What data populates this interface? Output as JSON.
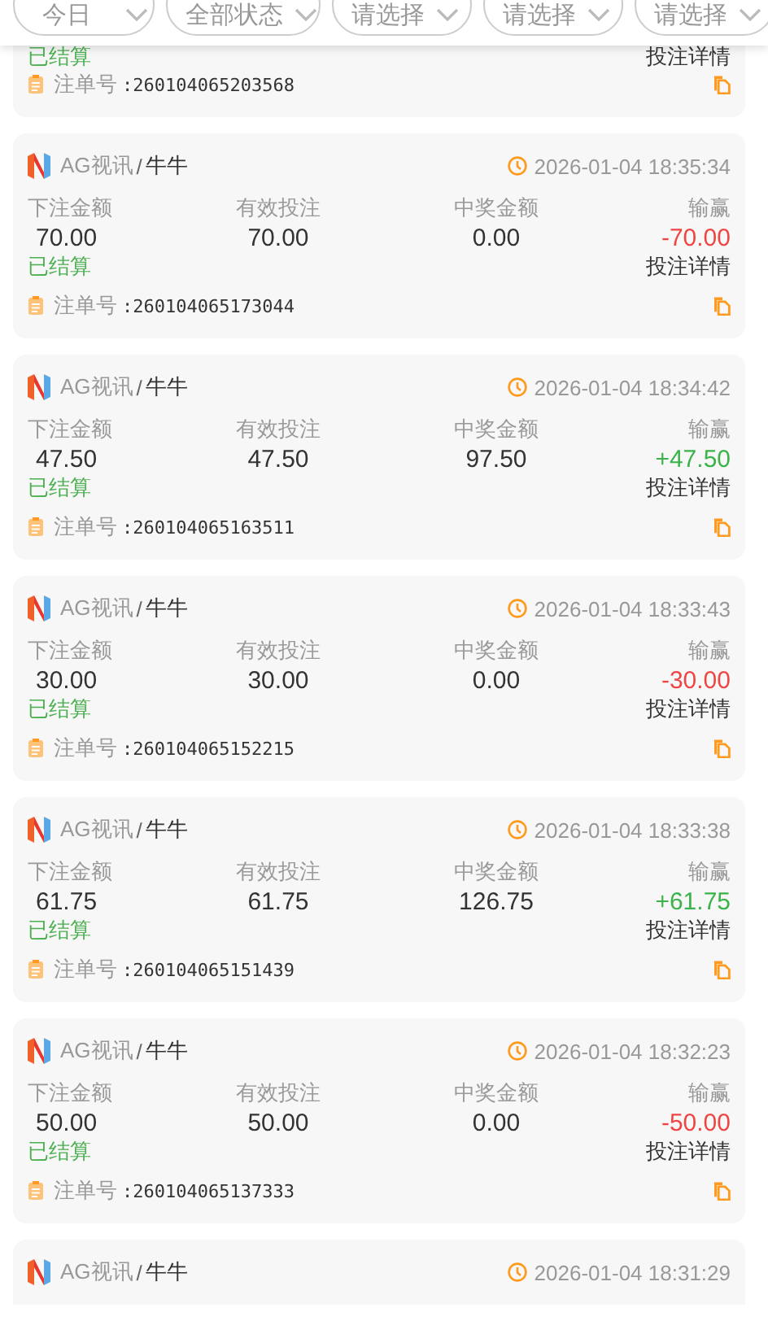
{
  "filters": [
    {
      "label": "今日"
    },
    {
      "label": "全部状态"
    },
    {
      "label": "请选择"
    },
    {
      "label": "请选择"
    },
    {
      "label": "请选择"
    }
  ],
  "bets": [
    {
      "kind": "partial-top",
      "status": "已结算",
      "details_link": "投注详情",
      "order_label": "注单号",
      "order_no": ":260104065203568"
    },
    {
      "kind": "full",
      "platform": "AG视讯",
      "separator": "/",
      "game": "牛牛",
      "time": "2026-01-04 18:35:34",
      "labels": [
        "下注金额",
        "有效投注",
        "中奖金额",
        "输赢"
      ],
      "stake": "70.00",
      "valid": "70.00",
      "payout": "0.00",
      "result": "-70.00",
      "win": false,
      "status": "已结算",
      "details_link": "投注详情",
      "order_label": "注单号",
      "order_no": ":260104065173044"
    },
    {
      "kind": "full",
      "platform": "AG视讯",
      "separator": "/",
      "game": "牛牛",
      "time": "2026-01-04 18:34:42",
      "labels": [
        "下注金额",
        "有效投注",
        "中奖金额",
        "输赢"
      ],
      "stake": "47.50",
      "valid": "47.50",
      "payout": "97.50",
      "result": "+47.50",
      "win": true,
      "status": "已结算",
      "details_link": "投注详情",
      "order_label": "注单号",
      "order_no": ":260104065163511"
    },
    {
      "kind": "full",
      "platform": "AG视讯",
      "separator": "/",
      "game": "牛牛",
      "time": "2026-01-04 18:33:43",
      "labels": [
        "下注金额",
        "有效投注",
        "中奖金额",
        "输赢"
      ],
      "stake": "30.00",
      "valid": "30.00",
      "payout": "0.00",
      "result": "-30.00",
      "win": false,
      "status": "已结算",
      "details_link": "投注详情",
      "order_label": "注单号",
      "order_no": ":260104065152215"
    },
    {
      "kind": "full",
      "platform": "AG视讯",
      "separator": "/",
      "game": "牛牛",
      "time": "2026-01-04 18:33:38",
      "labels": [
        "下注金额",
        "有效投注",
        "中奖金额",
        "输赢"
      ],
      "stake": "61.75",
      "valid": "61.75",
      "payout": "126.75",
      "result": "+61.75",
      "win": true,
      "status": "已结算",
      "details_link": "投注详情",
      "order_label": "注单号",
      "order_no": ":260104065151439"
    },
    {
      "kind": "full",
      "platform": "AG视讯",
      "separator": "/",
      "game": "牛牛",
      "time": "2026-01-04 18:32:23",
      "labels": [
        "下注金额",
        "有效投注",
        "中奖金额",
        "输赢"
      ],
      "stake": "50.00",
      "valid": "50.00",
      "payout": "0.00",
      "result": "-50.00",
      "win": false,
      "status": "已结算",
      "details_link": "投注详情",
      "order_label": "注单号",
      "order_no": ":260104065137333"
    },
    {
      "kind": "partial-bottom",
      "platform": "AG视讯",
      "separator": "/",
      "game": "牛牛",
      "time": "2026-01-04 18:31:29"
    }
  ]
}
